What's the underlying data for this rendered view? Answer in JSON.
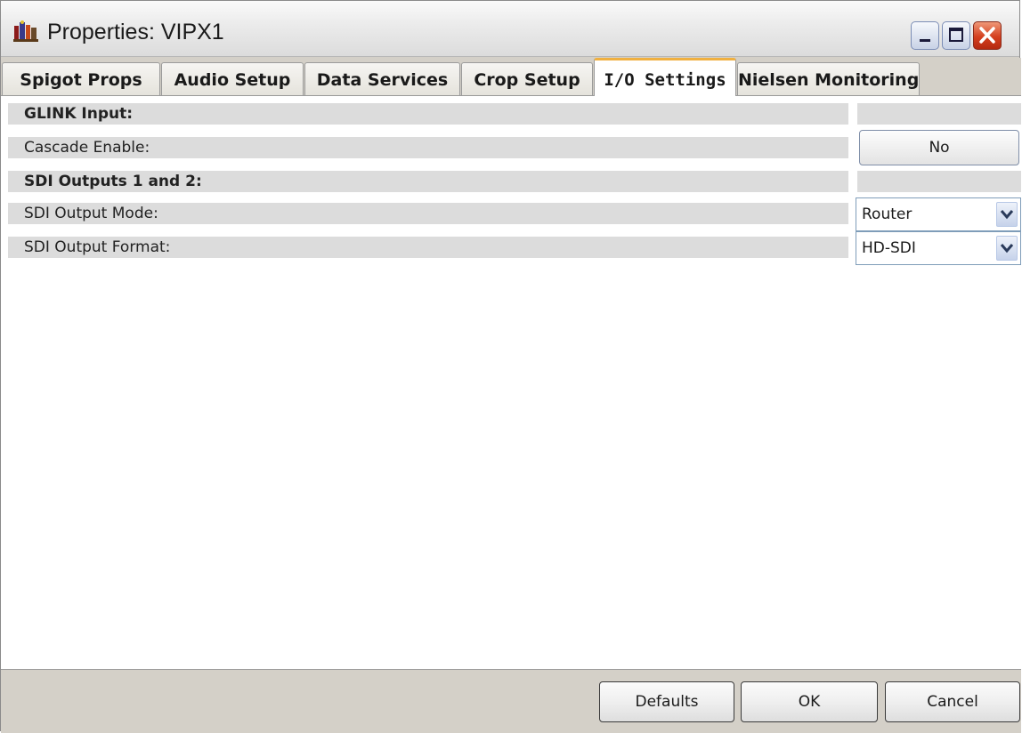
{
  "window": {
    "title": "Properties: VIPX1"
  },
  "tabs": [
    {
      "label": "Spigot Props",
      "active": false
    },
    {
      "label": "Audio Setup",
      "active": false
    },
    {
      "label": "Data Services",
      "active": false
    },
    {
      "label": "Crop Setup",
      "active": false
    },
    {
      "label": "I/O Settings",
      "active": true
    },
    {
      "label": "Nielsen Monitoring",
      "active": false
    }
  ],
  "settings": {
    "glink_header": "GLINK Input:",
    "cascade_label": "Cascade Enable:",
    "cascade_value": "No",
    "sdi_header": "SDI Outputs 1 and 2:",
    "output_mode_label": "SDI Output Mode:",
    "output_mode_value": "Router",
    "output_format_label": "SDI Output Format:",
    "output_format_value": "HD-SDI"
  },
  "footer": {
    "defaults_label": "Defaults",
    "ok_label": "OK",
    "cancel_label": "Cancel"
  },
  "colors": {
    "active_tab_accent": "#f0b040",
    "close_button": "#d4401e"
  },
  "icons": [
    "app-icon",
    "minimize-icon",
    "maximize-icon",
    "close-icon",
    "chevron-down-icon"
  ]
}
